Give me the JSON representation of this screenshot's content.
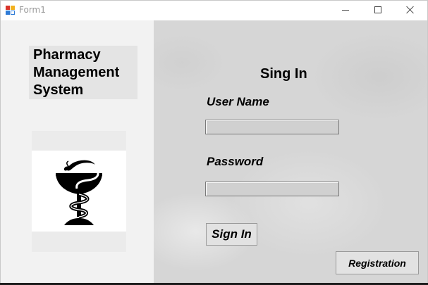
{
  "window": {
    "title": "Form1",
    "controls": [
      "minimize-icon",
      "maximize-icon",
      "close-icon"
    ]
  },
  "sidebar": {
    "app_title": "Pharmacy\nManagement\nSystem",
    "logo_icon": "bowl-of-hygieia-icon"
  },
  "login": {
    "heading": "Sing In",
    "username_label": "User Name",
    "username_value": "",
    "password_label": "Password",
    "password_value": "",
    "signin_label": "Sign In",
    "registration_label": "Registration"
  },
  "colors": {
    "right_panel": "#d6d6d6",
    "left_panel": "#f2f2f2",
    "input_fill": "#d0d0d0",
    "button_fill": "#e2e2e2"
  }
}
